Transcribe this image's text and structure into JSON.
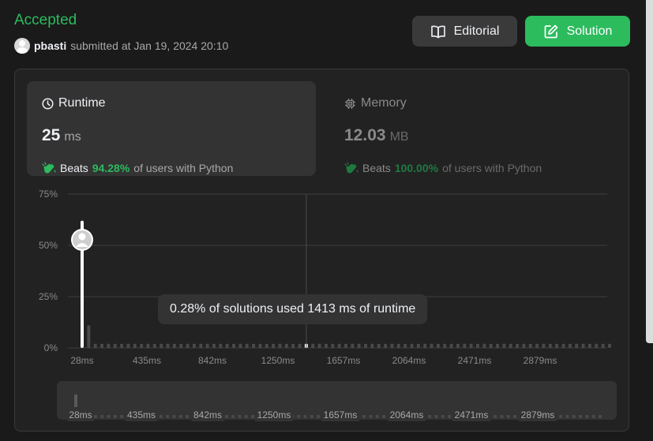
{
  "status": "Accepted",
  "submitter": {
    "username": "pbasti",
    "submitted_text": "submitted at Jan 19, 2024 20:10"
  },
  "buttons": {
    "editorial": "Editorial",
    "solution": "Solution"
  },
  "runtime": {
    "title": "Runtime",
    "value": "25",
    "unit": "ms",
    "beats_label": "Beats",
    "beats_pct": "94.28%",
    "beats_suffix": "of users with Python"
  },
  "memory": {
    "title": "Memory",
    "value": "12.03",
    "unit": "MB",
    "beats_label": "Beats",
    "beats_pct": "100.00%",
    "beats_suffix": "of users with Python"
  },
  "tooltip": "0.28% of solutions used 1413 ms of runtime",
  "colors": {
    "accent_green": "#2cbb5d",
    "background": "#1a1a1a",
    "panel": "#222222"
  },
  "chart_data": {
    "type": "bar",
    "title": "",
    "xlabel": "",
    "ylabel": "",
    "ylim": [
      0,
      75
    ],
    "y_ticks": [
      "0%",
      "25%",
      "50%",
      "75%"
    ],
    "x_ticks": [
      "28ms",
      "435ms",
      "842ms",
      "1250ms",
      "1657ms",
      "2064ms",
      "2471ms",
      "2879ms"
    ],
    "series": [
      {
        "values": [
          62,
          11,
          2,
          2,
          2,
          2,
          2,
          2,
          2,
          2,
          2,
          2,
          2,
          2,
          2,
          2,
          2,
          2,
          2,
          2,
          2,
          2,
          2,
          2,
          2,
          2,
          2,
          2,
          2,
          2,
          2,
          2,
          2,
          2,
          2,
          2,
          2,
          2,
          2,
          2,
          2,
          2,
          2,
          2,
          2,
          2,
          2,
          2,
          2,
          2,
          2,
          2,
          2,
          2,
          2,
          2,
          2,
          2,
          2,
          2,
          2,
          2,
          2,
          2,
          2,
          2,
          2,
          2,
          2,
          2,
          2,
          2,
          2,
          2,
          2,
          2,
          2,
          2,
          2,
          2,
          2
        ]
      }
    ],
    "user_bin_index": 0,
    "hover_bin_index": 34
  },
  "navigator": {
    "x_ticks": [
      "28ms",
      "435ms",
      "842ms",
      "1250ms",
      "1657ms",
      "2064ms",
      "2471ms",
      "2879ms"
    ]
  }
}
